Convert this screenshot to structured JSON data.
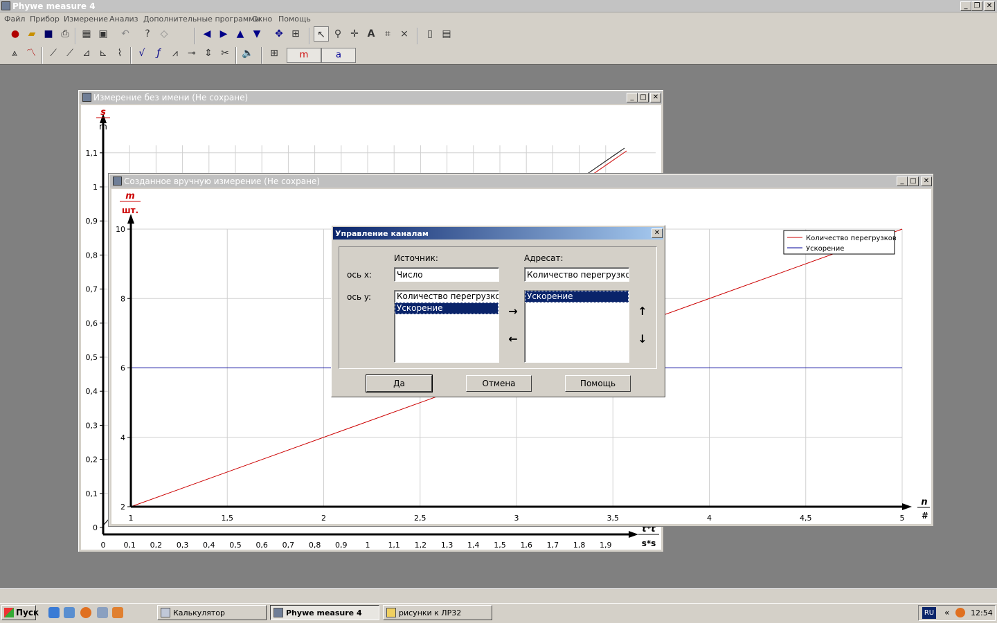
{
  "app": {
    "title": "Phywe measure 4"
  },
  "menu": [
    "Файл",
    "Прибор",
    "Измерение",
    "Анализ",
    "Дополнительные программы",
    "Окно",
    "Помощь"
  ],
  "toolbar2": {
    "channel_m": "m",
    "channel_a": "a"
  },
  "window_back": {
    "title": "Измерение без имени (Не сохране)",
    "y_axis": {
      "name": "s",
      "unit": "m",
      "ticks": [
        "1,1",
        "1",
        "0,9",
        "0,8",
        "0,7",
        "0,6",
        "0,5",
        "0,4",
        "0,3",
        "0,2",
        "0,1",
        "0"
      ]
    },
    "x_axis": {
      "name": "t*t",
      "unit": "s*s",
      "ticks": [
        "0",
        "0,1",
        "0,2",
        "0,3",
        "0,4",
        "0,5",
        "0,6",
        "0,7",
        "0,8",
        "0,9",
        "1",
        "1,1",
        "1,2",
        "1,3",
        "1,4",
        "1,5",
        "1,6",
        "1,7",
        "1,8",
        "1,9"
      ]
    }
  },
  "window_front": {
    "title": "Созданное вручную измерение (Не сохране)",
    "legend": [
      {
        "label": "Количество перегрузков",
        "color": "#cc0000"
      },
      {
        "label": "Ускорение",
        "color": "#000099"
      }
    ]
  },
  "chart_data": {
    "type": "line",
    "y_axis": {
      "name": "m",
      "unit": "шт.",
      "ticks": [
        "10",
        "8",
        "6",
        "4",
        "2"
      ],
      "ylim": [
        2,
        10
      ]
    },
    "x_axis": {
      "name": "n",
      "unit": "#",
      "ticks": [
        "1",
        "1,5",
        "2",
        "2,5",
        "3",
        "3,5",
        "4",
        "4,5",
        "5"
      ],
      "xlim": [
        1,
        5
      ]
    },
    "grid": true,
    "legend_position": "top-right",
    "series": [
      {
        "name": "Количество перегрузков",
        "color": "#cc0000",
        "x": [
          1,
          5
        ],
        "y": [
          2,
          10
        ]
      },
      {
        "name": "Ускорение",
        "color": "#000099",
        "x": [
          1,
          5
        ],
        "y": [
          6,
          6
        ]
      }
    ]
  },
  "dialog": {
    "title": "Управление каналам",
    "source_label": "Источник:",
    "dest_label": "Адресат:",
    "x_axis_label": "ось x:",
    "y_axis_label": "ось y:",
    "x_source_value": "Число",
    "x_dest_value": "Количество перегрузков",
    "source_list": [
      "Количество перегрузков",
      "Ускорение"
    ],
    "dest_list": [
      "Ускорение"
    ],
    "ok": "Да",
    "cancel": "Отмена",
    "help": "Помощь"
  },
  "taskbar": {
    "start": "Пуск",
    "tasks": [
      "Калькулятор",
      "Phywe measure 4",
      "рисунки к ЛР32"
    ],
    "lang": "RU",
    "clock": "12:54"
  }
}
